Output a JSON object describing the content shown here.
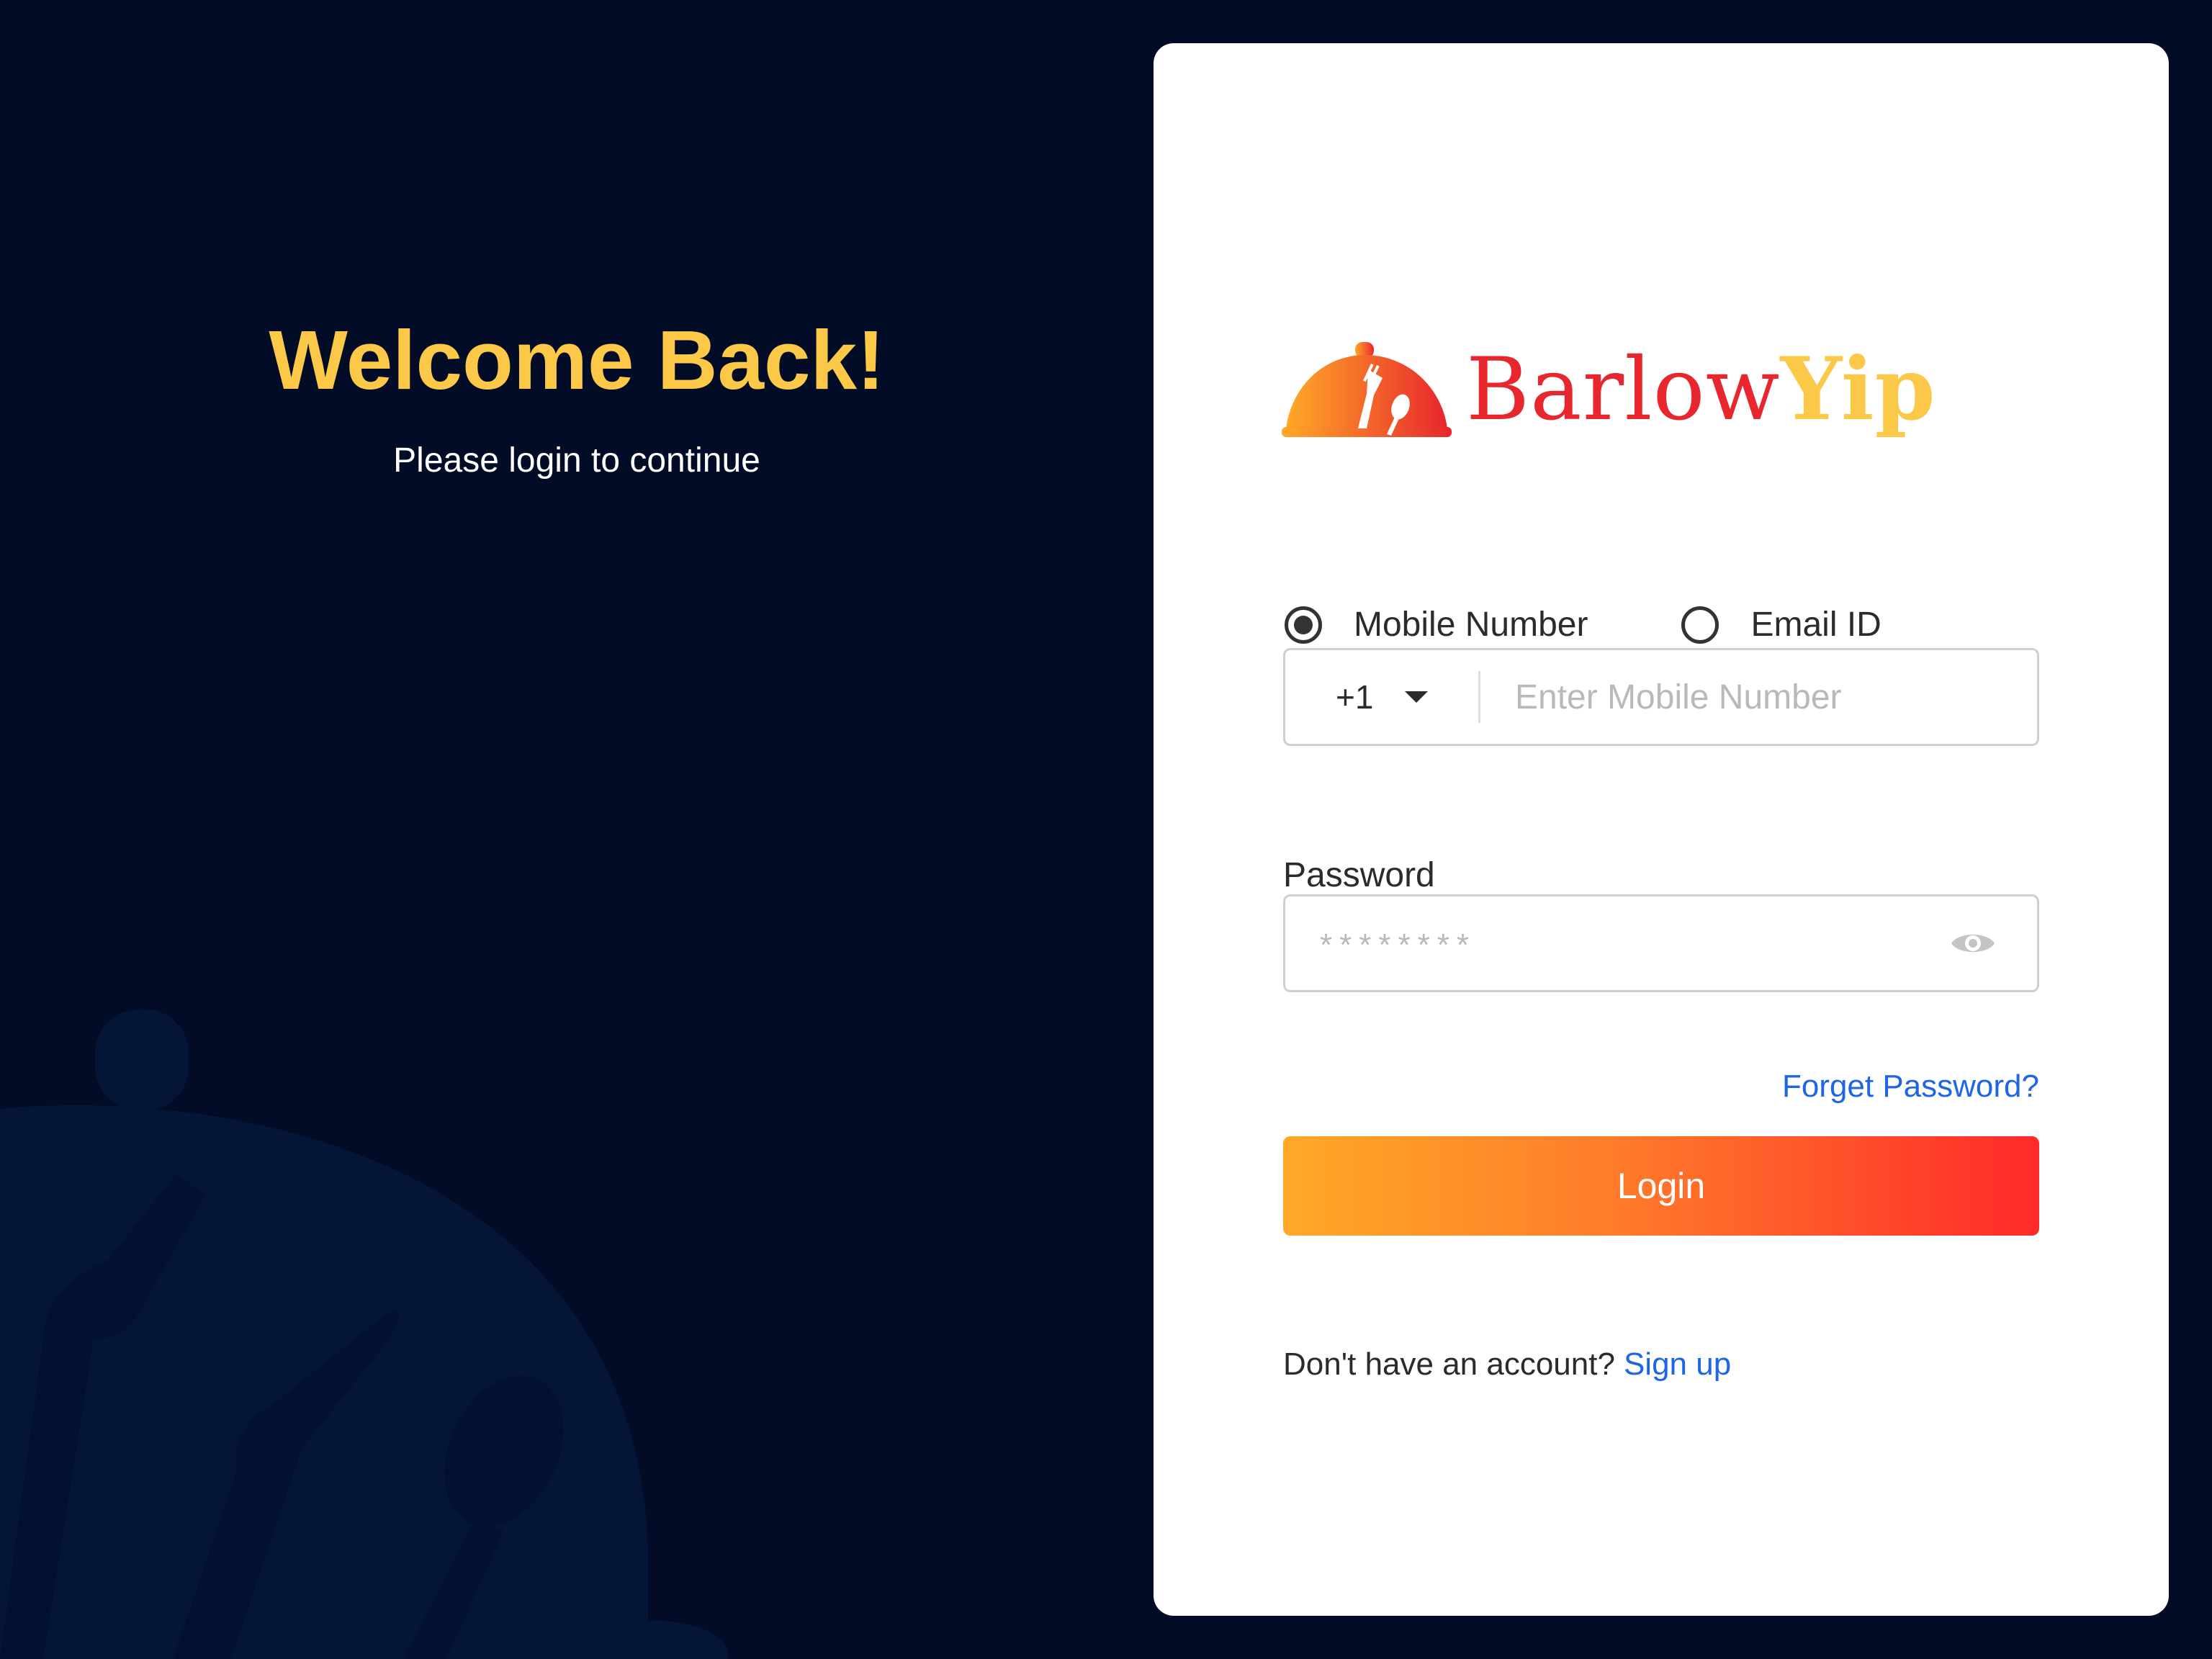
{
  "welcome": {
    "title": "Welcome Back!",
    "subtitle": "Please login to continue"
  },
  "logo": {
    "icon": "cloche-utensils-icon",
    "brand_part1": "Barlow",
    "brand_part2": "Yip"
  },
  "login_method": {
    "options": [
      {
        "label": "Mobile Number",
        "selected": true
      },
      {
        "label": "Email ID",
        "selected": false
      }
    ]
  },
  "mobile": {
    "country_code": "+1",
    "placeholder": "Enter Mobile Number",
    "value": ""
  },
  "password": {
    "label": "Password",
    "masked_value": "********",
    "toggle_icon": "eye-icon"
  },
  "links": {
    "forgot_password": "Forget Password?",
    "no_account_text": "Don't have an account?",
    "signup": "Sign up"
  },
  "buttons": {
    "login": "Login"
  },
  "colors": {
    "background": "#020c26",
    "accent_yellow": "#fbc947",
    "brand_red": "#e8262d",
    "link_blue": "#1e66e6",
    "login_gradient_start": "#ffa927",
    "login_gradient_end": "#ff2a2a"
  }
}
